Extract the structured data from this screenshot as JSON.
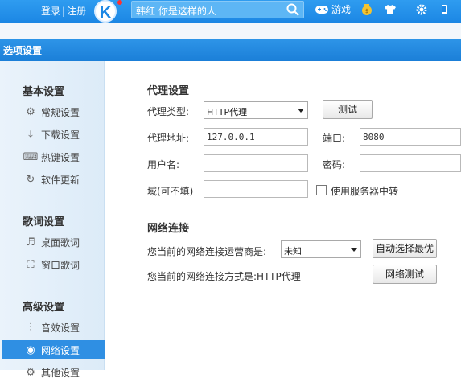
{
  "topbar": {
    "login": "登录",
    "register": "注册",
    "search_hint": "韩红  你是这样的人",
    "game": "游戏"
  },
  "dialog": {
    "title": "选项设置"
  },
  "sidebar": {
    "basic": {
      "title": "基本设置",
      "items": [
        "常规设置",
        "下载设置",
        "热键设置",
        "软件更新"
      ]
    },
    "lyrics": {
      "title": "歌词设置",
      "items": [
        "桌面歌词",
        "窗口歌词"
      ]
    },
    "advanced": {
      "title": "高级设置",
      "items": [
        "音效设置",
        "网络设置",
        "其他设置"
      ]
    }
  },
  "proxy": {
    "title": "代理设置",
    "type_label": "代理类型:",
    "type_value": "HTTP代理",
    "test_button": "测试",
    "address_label": "代理地址:",
    "address_value": "127.0.0.1",
    "port_label": "端口:",
    "port_value": "8080",
    "username_label": "用户名:",
    "username_value": "",
    "password_label": "密码:",
    "password_value": "",
    "domain_label": "域(可不填)",
    "domain_value": "",
    "relay_label": "使用服务器中转"
  },
  "network": {
    "title": "网络连接",
    "isp_label": "您当前的网络连接运营商是:",
    "isp_value": "未知",
    "auto_button": "自动选择最优",
    "mode_label": "您当前的网络连接方式是:HTTP代理",
    "test_button": "网络测试"
  }
}
